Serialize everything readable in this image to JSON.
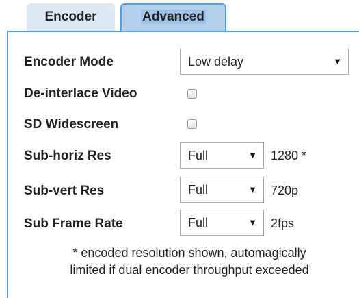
{
  "tabs": {
    "encoder": "Encoder",
    "advanced": "Advanced"
  },
  "rows": {
    "encoder_mode": {
      "label": "Encoder Mode",
      "value": "Low delay"
    },
    "deinterlace": {
      "label": "De-interlace Video",
      "checked": false
    },
    "sd_widescreen": {
      "label": "SD Widescreen",
      "checked": false
    },
    "sub_horiz": {
      "label": "Sub-horiz Res",
      "value": "Full",
      "result": "1280 *"
    },
    "sub_vert": {
      "label": "Sub-vert Res",
      "value": "Full",
      "result": "720p"
    },
    "sub_frame": {
      "label": "Sub Frame Rate",
      "value": "Full",
      "result": "2fps"
    }
  },
  "note": {
    "line1": "* encoded resolution shown, automagically",
    "line2": "limited if dual encoder throughput exceeded"
  },
  "icons": {
    "dropdown": "caret-down-icon"
  }
}
